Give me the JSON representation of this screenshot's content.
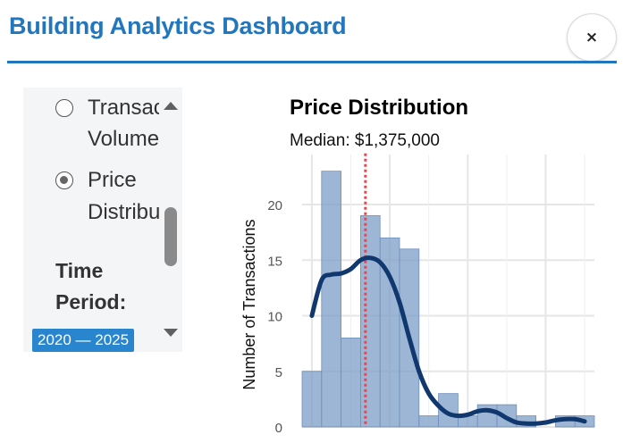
{
  "window": {
    "title": "Building Analytics Dashboard",
    "close_label": "×"
  },
  "sidebar": {
    "options": [
      {
        "line1": "Transac",
        "line2": "Volume",
        "selected": false
      },
      {
        "line1": "Price",
        "line2": "Distribu",
        "selected": true
      }
    ],
    "time_period_label_line1": "Time",
    "time_period_label_line2": "Period:",
    "time_range": "2020 — 2025"
  },
  "chart_data": {
    "type": "bar",
    "title": "Price Distribution",
    "subtitle": "Median: $1,375,000",
    "ylabel": "Number of Transactions",
    "xlabel": "",
    "ylim": [
      0,
      24
    ],
    "yticks": [
      0,
      5,
      10,
      15,
      20
    ],
    "grid": true,
    "bar_color": "#7d9ec8",
    "density_color": "#10386e",
    "median_line_color": "#e8454f",
    "bins": [
      {
        "count": 5
      },
      {
        "count": 23
      },
      {
        "count": 8
      },
      {
        "count": 19
      },
      {
        "count": 17
      },
      {
        "count": 16
      },
      {
        "count": 1
      },
      {
        "count": 3
      },
      {
        "count": 1
      },
      {
        "count": 2
      },
      {
        "count": 2
      },
      {
        "count": 1
      },
      {
        "count": 0
      },
      {
        "count": 1
      },
      {
        "count": 1
      }
    ],
    "density": [
      [
        0.5,
        10.0
      ],
      [
        1.0,
        13.2
      ],
      [
        1.5,
        13.7
      ],
      [
        2.0,
        13.8
      ],
      [
        2.5,
        14.2
      ],
      [
        3.0,
        15.0
      ],
      [
        3.5,
        15.2
      ],
      [
        4.0,
        14.8
      ],
      [
        4.5,
        13.5
      ],
      [
        5.0,
        11.2
      ],
      [
        5.5,
        8.0
      ],
      [
        6.0,
        5.0
      ],
      [
        6.5,
        3.0
      ],
      [
        7.0,
        1.9
      ],
      [
        7.5,
        1.2
      ],
      [
        8.0,
        1.0
      ],
      [
        8.5,
        1.1
      ],
      [
        9.0,
        1.4
      ],
      [
        9.5,
        1.5
      ],
      [
        10.0,
        1.3
      ],
      [
        10.5,
        0.8
      ],
      [
        11.0,
        0.4
      ],
      [
        11.5,
        0.3
      ],
      [
        12.0,
        0.3
      ],
      [
        12.5,
        0.4
      ],
      [
        13.0,
        0.6
      ],
      [
        13.5,
        0.7
      ],
      [
        14.0,
        0.7
      ],
      [
        14.5,
        0.5
      ]
    ],
    "median_bin_position": 3.25
  }
}
